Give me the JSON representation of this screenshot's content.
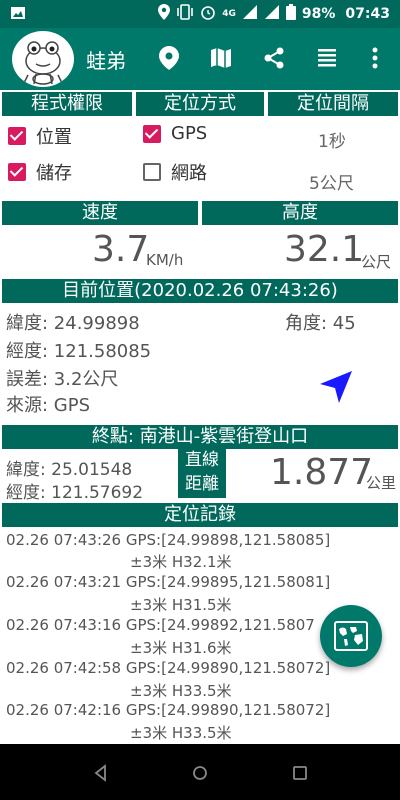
{
  "status": {
    "battery": "98%",
    "time": "07:43",
    "network": "4G"
  },
  "app": {
    "title": "蛙弟"
  },
  "toolbar": {
    "icons": [
      "location-pin-icon",
      "map-icon",
      "share-icon",
      "list-icon",
      "more-vert-icon"
    ]
  },
  "permissions": {
    "header": "程式權限",
    "items": [
      {
        "label": "位置",
        "checked": true
      },
      {
        "label": "儲存",
        "checked": true
      }
    ]
  },
  "positioning": {
    "header": "定位方式",
    "items": [
      {
        "label": "GPS",
        "checked": true
      },
      {
        "label": "網路",
        "checked": false
      }
    ]
  },
  "interval": {
    "header": "定位間隔",
    "time": "1秒",
    "distance": "5公尺"
  },
  "speed": {
    "header": "速度",
    "value": "3.7",
    "unit": "KM/h"
  },
  "altitude": {
    "header": "高度",
    "value": "32.1",
    "unit": "公尺"
  },
  "current": {
    "header": "目前位置(2020.02.26 07:43:26)",
    "lat": "緯度: 24.99898",
    "lon": "經度: 121.58085",
    "error": "誤差: 3.2公尺",
    "source": "來源: GPS",
    "angle": "角度: 45"
  },
  "destination": {
    "header": "終點: 南港山-紫雲街登山口",
    "lat": "緯度: 25.01548",
    "lon": "經度: 121.57692",
    "label_line1": "直線",
    "label_line2": "距離",
    "distance": "1.877",
    "unit": "公里"
  },
  "log": {
    "header": "定位記錄",
    "entries": [
      {
        "line1": "02.26 07:43:26 GPS:[24.99898,121.58085]",
        "line2": "±3米 H32.1米"
      },
      {
        "line1": "02.26 07:43:21 GPS:[24.99895,121.58081]",
        "line2": "±3米 H31.5米"
      },
      {
        "line1": "02.26 07:43:16 GPS:[24.99892,121.5807",
        "line2": "±3米 H31.6米"
      },
      {
        "line1": "02.26 07:42:58 GPS:[24.99890,121.58072]",
        "line2": "±3米 H33.5米"
      },
      {
        "line1": "02.26 07:42:16 GPS:[24.99890,121.58072]",
        "line2": "±3米 H33.5米"
      }
    ]
  },
  "colors": {
    "primary": "#00796b",
    "primary_dark": "#00695c",
    "accent": "#d81b60",
    "arrow": "#1a1aff"
  }
}
